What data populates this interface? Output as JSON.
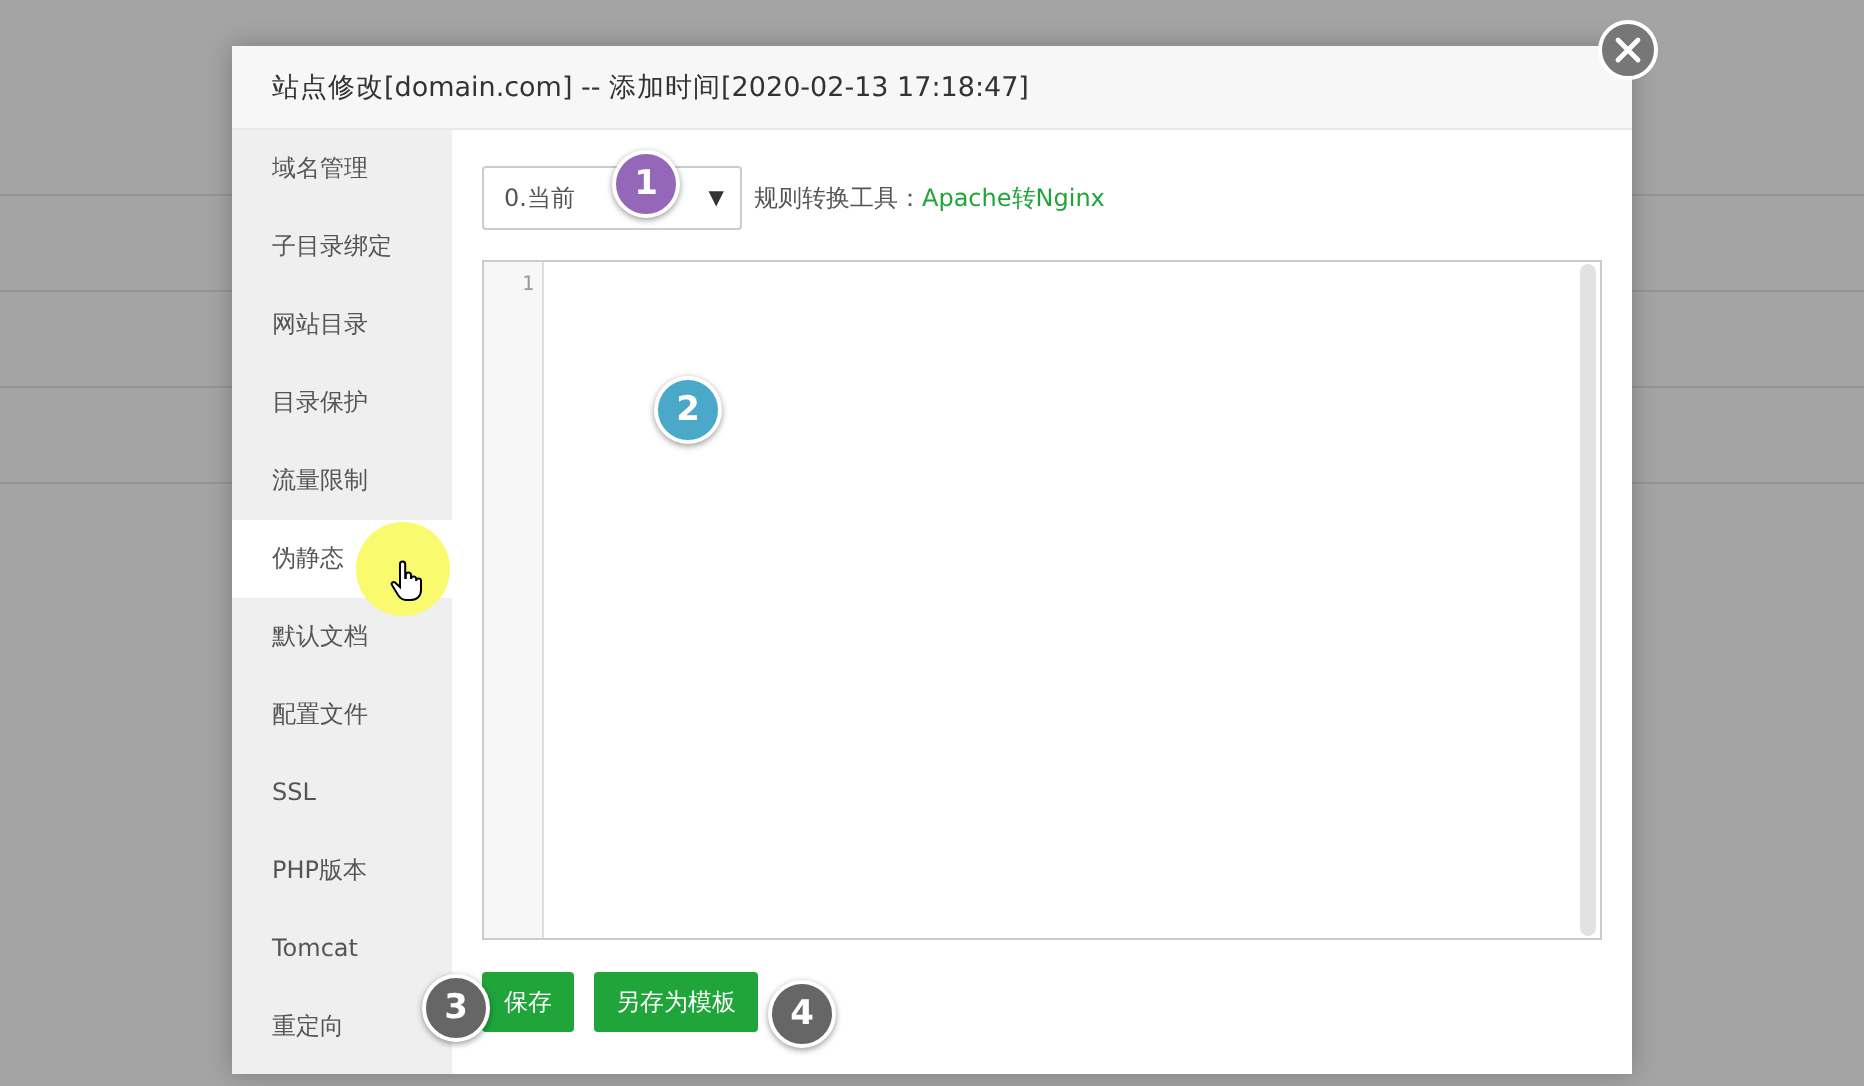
{
  "dialog": {
    "title": "站点修改[domain.com] -- 添加时间[2020-02-13 17:18:47]"
  },
  "sidebar": {
    "items": [
      {
        "label": "域名管理",
        "selected": false
      },
      {
        "label": "子目录绑定",
        "selected": false
      },
      {
        "label": "网站目录",
        "selected": false
      },
      {
        "label": "目录保护",
        "selected": false
      },
      {
        "label": "流量限制",
        "selected": false
      },
      {
        "label": "伪静态",
        "selected": true
      },
      {
        "label": "默认文档",
        "selected": false
      },
      {
        "label": "配置文件",
        "selected": false
      },
      {
        "label": "SSL",
        "selected": false
      },
      {
        "label": "PHP版本",
        "selected": false
      },
      {
        "label": "Tomcat",
        "selected": false
      },
      {
        "label": "重定向",
        "selected": false
      }
    ]
  },
  "rewrite_select": {
    "value": "0.当前",
    "arrow": "▼"
  },
  "tool_label": "规则转换工具：",
  "tool_link": "Apache转Nginx",
  "editor": {
    "line_numbers": [
      "1"
    ]
  },
  "buttons": [
    "保存",
    "另存为模板"
  ],
  "markers": [
    {
      "label": "1",
      "color": "#9567b8"
    },
    {
      "label": "2",
      "color": "#4aa8c8"
    },
    {
      "label": "3",
      "color": "#666666"
    },
    {
      "label": "4",
      "color": "#666666"
    }
  ]
}
